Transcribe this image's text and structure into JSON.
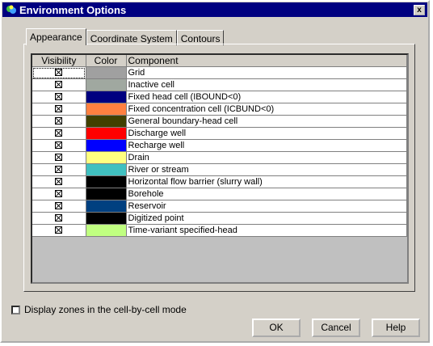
{
  "window": {
    "title": "Environment Options",
    "close_label": "x"
  },
  "tabs": [
    {
      "label": "Appearance",
      "active": true
    },
    {
      "label": "Coordinate System",
      "active": false
    },
    {
      "label": "Contours",
      "active": false
    }
  ],
  "grid": {
    "headers": {
      "visibility": "Visibility",
      "color": "Color",
      "component": "Component"
    },
    "rows": [
      {
        "visible": true,
        "color": "#a0a0a0",
        "component": "Grid"
      },
      {
        "visible": true,
        "color": "#a0a8a0",
        "component": "Inactive cell"
      },
      {
        "visible": true,
        "color": "#000080",
        "component": "Fixed head cell (IBOUND<0)"
      },
      {
        "visible": true,
        "color": "#ff8040",
        "component": "Fixed concentration cell (ICBUND<0)"
      },
      {
        "visible": true,
        "color": "#404000",
        "component": "General boundary-head cell"
      },
      {
        "visible": true,
        "color": "#ff0000",
        "component": "Discharge well"
      },
      {
        "visible": true,
        "color": "#0000ff",
        "component": "Recharge well"
      },
      {
        "visible": true,
        "color": "#ffff80",
        "component": "Drain"
      },
      {
        "visible": true,
        "color": "#40c0c0",
        "component": "River or stream"
      },
      {
        "visible": true,
        "color": "#000000",
        "component": "Horizontal flow barrier (slurry wall)"
      },
      {
        "visible": true,
        "color": "#000000",
        "component": "Borehole"
      },
      {
        "visible": true,
        "color": "#004080",
        "component": "Reservoir"
      },
      {
        "visible": true,
        "color": "#000000",
        "component": "Digitized point"
      },
      {
        "visible": true,
        "color": "#c0ff80",
        "component": "Time-variant specified-head"
      }
    ]
  },
  "options": {
    "display_zones_label": "Display zones in the cell-by-cell mode",
    "display_zones_checked": false
  },
  "buttons": {
    "ok": "OK",
    "cancel": "Cancel",
    "help": "Help"
  }
}
